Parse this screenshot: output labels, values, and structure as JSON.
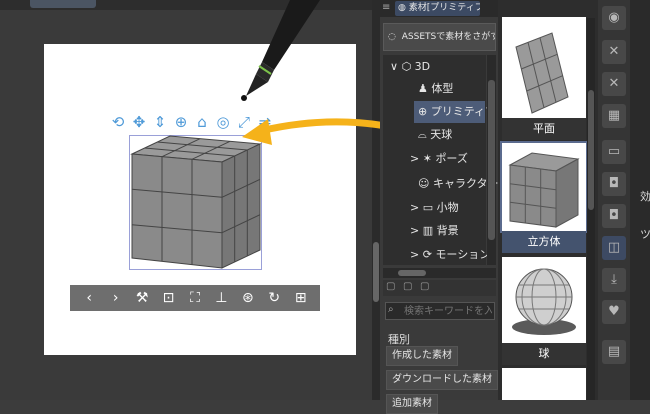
{
  "canvas": {
    "manipulator_icons": [
      "rotate-icon",
      "move-icon",
      "pan-icon",
      "center-icon",
      "camera-icon",
      "orbit-icon",
      "scale-icon",
      "flip-icon"
    ],
    "toolbar": [
      "chevron-left-icon",
      "chevron-right-icon",
      "wrench-icon",
      "camera-fit-icon",
      "fit-frame-icon",
      "floor-icon",
      "object-link-icon",
      "rotate-reset-icon",
      "layer-icon"
    ]
  },
  "materials": {
    "tab_title": "素材[プリミティブ]",
    "assets_button": "ASSETSで素材をさがす",
    "tree": [
      {
        "label": "3D",
        "icon": "cube-icon",
        "expand": "∨"
      },
      {
        "label": "体型",
        "icon": "figure-icon",
        "expand": ""
      },
      {
        "label": "プリミティブ",
        "icon": "globe-icon",
        "expand": "",
        "selected": true
      },
      {
        "label": "天球",
        "icon": "dome-icon",
        "expand": ""
      },
      {
        "label": "ポーズ",
        "icon": "pose-icon",
        "expand": ">"
      },
      {
        "label": "キャラクター",
        "icon": "character-icon",
        "expand": ""
      },
      {
        "label": "小物",
        "icon": "folder-icon",
        "expand": ">"
      },
      {
        "label": "背景",
        "icon": "building-icon",
        "expand": ">"
      },
      {
        "label": "モーション",
        "icon": "motion-icon",
        "expand": ">"
      }
    ],
    "search_placeholder": "検索キーワードを入...",
    "category_label": "種別",
    "filters": [
      "作成した素材",
      "ダウンロードした素材",
      "追加素材"
    ],
    "thumbnails": [
      {
        "label": "平面",
        "selected": false
      },
      {
        "label": "立方体",
        "selected": true
      },
      {
        "label": "球",
        "selected": false
      }
    ]
  },
  "right_strip": {
    "far_text": [
      "効",
      "ツ"
    ]
  },
  "colors": {
    "accent": "#4d5c78",
    "arrow": "#f5b21a",
    "manipulator": "#4f9ad8"
  }
}
